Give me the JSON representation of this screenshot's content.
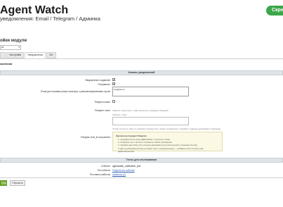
{
  "header": {
    "title": "Agent Watch",
    "subtitle": "уведомления: Email / Telegram / Админка",
    "action_button": "Скри"
  },
  "module": {
    "title": "ойки модуля",
    "gear_icon": "gear-icon",
    "select_value": "s1"
  },
  "tabs": [
    {
      "label": ""
    },
    {
      "label": "Настройки"
    },
    {
      "label": "Уведомления"
    },
    {
      "label": "Лог"
    }
  ],
  "section": {
    "title": "омления"
  },
  "notification_settings": {
    "group_title": "Каналы уведомлений",
    "rows": [
      {
        "label": "Уведомление в админке",
        "checked": true
      },
      {
        "label": "Отправлять",
        "checked": true
      }
    ],
    "emails_label": "Email для отправки (через запятую) с уникальным/разными строки",
    "emails_value": "test@site.ru",
    "telegram_label": "Telegram канал",
    "telegram_checked": false,
    "token_label": "Telegram токен",
    "token_hint": "Укажите токен бота, чтобы включить отправку в Telegram",
    "chat_hint": "Описать, темы",
    "chat_placeholder": "",
    "chat_footnote": "Чтобы получить chat_id, напишите своему боту любое сообщение и откройте страницу getUpdates в браузере",
    "chat_label": "Telegram chat_id получателя",
    "note": {
      "title": "Краткая инструкция Telegram",
      "items": [
        "1. Создайте бота через @BotFather и получите токен",
        "2. Откройте чат с ботом и отправьте любое сообщение",
        "3. Узнайте ваш chat_id по ссылке getUpdates (или используйте сторонних ботов)",
        "4. Для групп/каналов chat_id может быть отрицательным — добавьте бота в группу как администратора"
      ]
    }
  },
  "info": {
    "group_title": "Тесты для отслеживания",
    "rows": [
      {
        "label": "Событие",
        "value": "agentwatch_notification_test",
        "link": false
      },
      {
        "label": "Тип событие",
        "value": "Открыть это событие",
        "link": true
      },
      {
        "label": "Почтовые шаблоны",
        "value": "Шаблоны (2)",
        "link": true
      }
    ]
  },
  "footer": {
    "save_label": "Сохр",
    "reset_label": "Сбросить"
  }
}
